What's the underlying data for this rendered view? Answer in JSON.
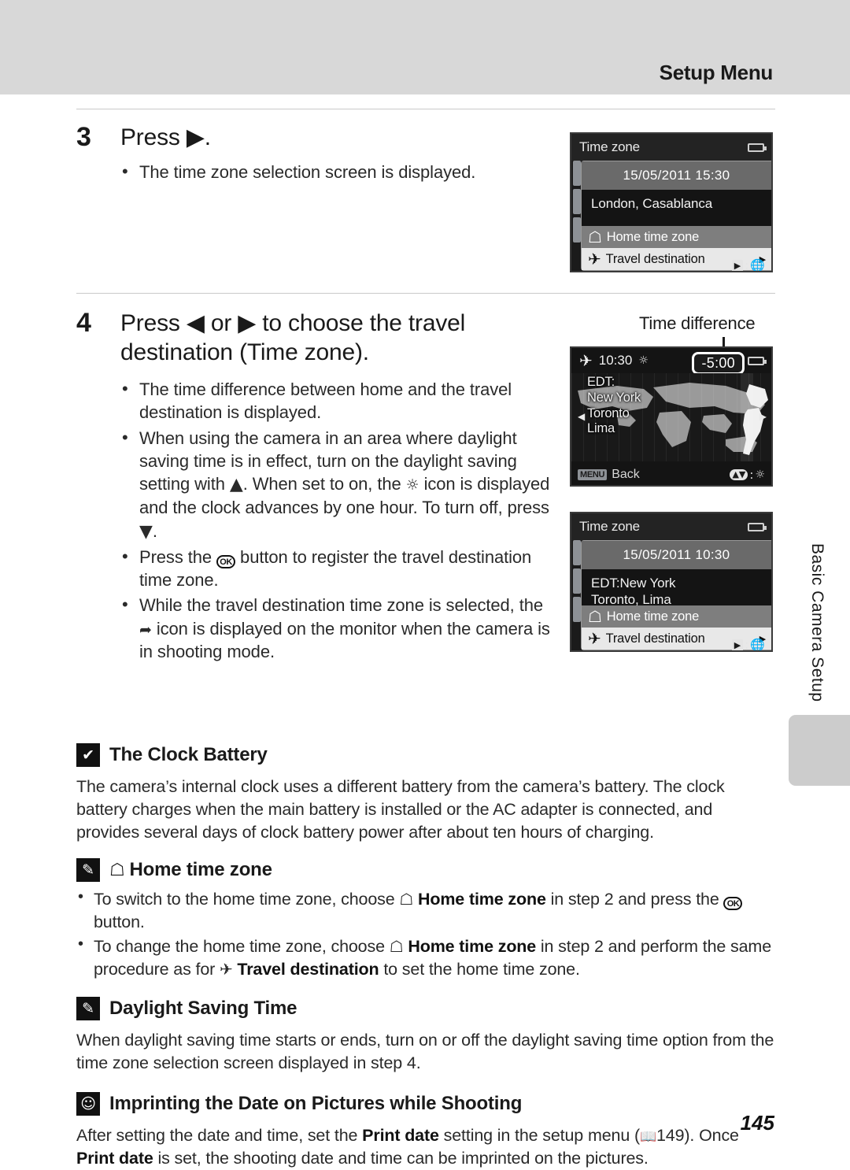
{
  "header": {
    "title": "Setup Menu"
  },
  "side_tab": {
    "label": "Basic Camera Setup"
  },
  "page_number": "145",
  "steps": [
    {
      "number": "3",
      "title_pre": "Press ",
      "title_post": ".",
      "bullets": [
        "The time zone selection screen is displayed."
      ]
    },
    {
      "number": "4",
      "title_pre": "Press ",
      "title_mid": " or ",
      "title_post": " to choose the travel destination (Time zone).",
      "bullets": [
        "The time difference between home and the travel destination is displayed.",
        "When using the camera in an area where daylight saving time is in effect, turn on the daylight saving setting with ",
        "Press the ",
        "While the travel destination time zone is selected, the "
      ],
      "bullet2_part2": ". When set to on, the ",
      "bullet2_part3": " icon is displayed and the clock advances by one hour. To turn off, press ",
      "bullet2_part4": ".",
      "bullet3_part2": " button to register the travel destination time zone.",
      "bullet4_part2": " icon is displayed on the monitor when the camera is in shooting mode."
    }
  ],
  "time_difference_caption": "Time difference",
  "screens": {
    "screen1": {
      "title": "Time zone",
      "datetime": "15/05/2011  15:30",
      "city": "London, Casablanca",
      "option_home": "Home time zone",
      "option_travel": "Travel destination",
      "battery_icon": "battery-icon",
      "footer_icon": "playback-globe-icon"
    },
    "screen2": {
      "time": "10:30",
      "time_difference": "-5:00",
      "zone_lines": [
        "EDT:",
        "New York",
        "Toronto",
        "Lima"
      ],
      "back_key": "MENU",
      "back_label": "Back",
      "dst_icon": "daylight-saving-icon",
      "updown_icon": "up-down-icon",
      "plane_icon": "plane-icon"
    },
    "screen3": {
      "title": "Time zone",
      "datetime": "15/05/2011  10:30",
      "city_line1": "EDT:New York",
      "city_line2": "Toronto, Lima",
      "option_home": "Home time zone",
      "option_travel": "Travel destination",
      "battery_icon": "battery-icon",
      "footer_icon": "playback-globe-icon"
    }
  },
  "notes": [
    {
      "icon": "caution-icon",
      "title": "The Clock Battery",
      "body": "The camera’s internal clock uses a different battery from the camera’s battery. The clock battery charges when the main battery is installed or the AC adapter is connected, and provides several days of clock battery power after about ten hours of charging."
    },
    {
      "icon": "pencil-note-icon",
      "title": "Home time zone",
      "items": [
        {
          "p1": "To switch to the home time zone, choose ",
          "b1": "Home time zone",
          "p2": " in step 2 and press the ",
          "p3": " button."
        },
        {
          "p1": "To change the home time zone, choose ",
          "b1": "Home time zone",
          "p2": " in step 2 and perform the same procedure as for ",
          "b2": "Travel destination",
          "p3": " to set the home time zone."
        }
      ]
    },
    {
      "icon": "pencil-note-icon",
      "title": "Daylight Saving Time",
      "body": "When daylight saving time starts or ends, turn on or off the daylight saving time option from the time zone selection screen displayed in step 4."
    },
    {
      "icon": "camera-note-icon",
      "title": "Imprinting the Date on Pictures while Shooting",
      "body_p1": "After setting the date and time, set the ",
      "body_b1": "Print date",
      "body_p2": " setting in the setup menu (",
      "body_ref": "149). Once ",
      "body_b2": "Print date",
      "body_p3": " is set, the shooting date and time can be imprinted on the pictures."
    }
  ]
}
